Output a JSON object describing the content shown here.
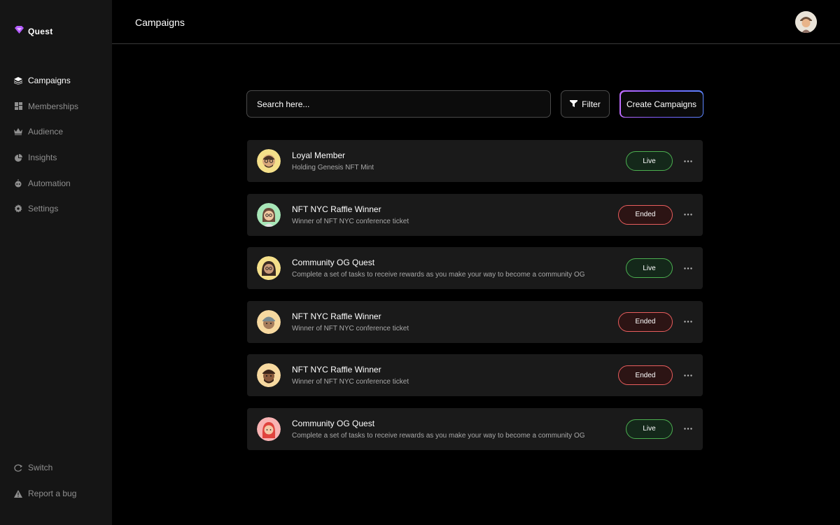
{
  "brand": {
    "name": "Quest",
    "logo_icon": "gem-icon",
    "logo_color": "#b45cff"
  },
  "sidebar": {
    "items": [
      {
        "label": "Campaigns",
        "icon": "layers-icon",
        "active": true
      },
      {
        "label": "Memberships",
        "icon": "grid-icon",
        "active": false
      },
      {
        "label": "Audience",
        "icon": "crown-icon",
        "active": false
      },
      {
        "label": "Insights",
        "icon": "pie-chart-icon",
        "active": false
      },
      {
        "label": "Automation",
        "icon": "robot-icon",
        "active": false
      },
      {
        "label": "Settings",
        "icon": "gear-icon",
        "active": false
      }
    ],
    "bottom_items": [
      {
        "label": "Switch",
        "icon": "switch-icon"
      },
      {
        "label": "Report a bug",
        "icon": "warning-icon"
      }
    ]
  },
  "header": {
    "title": "Campaigns"
  },
  "toolbar": {
    "search_placeholder": "Search here...",
    "filter_label": "Filter",
    "create_label": "Create Campaigns"
  },
  "campaigns": [
    {
      "title": "Loyal Member",
      "subtitle": "Holding Genesis NFT Mint",
      "status": "Live",
      "avatar_bg": "#f5e08a"
    },
    {
      "title": "NFT NYC Raffle Winner",
      "subtitle": "Winner of NFT NYC conference ticket",
      "status": "Ended",
      "avatar_bg": "#a8e6b8"
    },
    {
      "title": "Community OG Quest",
      "subtitle": "Complete a set of tasks to receive rewards as you make your way to become a community OG",
      "status": "Live",
      "avatar_bg": "#f5e08a"
    },
    {
      "title": "NFT NYC Raffle Winner",
      "subtitle": "Winner of NFT NYC conference ticket",
      "status": "Ended",
      "avatar_bg": "#f7d9a0"
    },
    {
      "title": "NFT NYC Raffle Winner",
      "subtitle": "Winner of NFT NYC conference ticket",
      "status": "Ended",
      "avatar_bg": "#f7d9a0"
    },
    {
      "title": "Community OG Quest",
      "subtitle": "Complete a set of tasks to receive rewards as you make your way to become a community OG",
      "status": "Live",
      "avatar_bg": "#f8b3b3"
    }
  ],
  "colors": {
    "live": "#4caf50",
    "ended": "#e85d5d",
    "accent_gradient_start": "#c06cff",
    "accent_gradient_end": "#5d86ff"
  }
}
